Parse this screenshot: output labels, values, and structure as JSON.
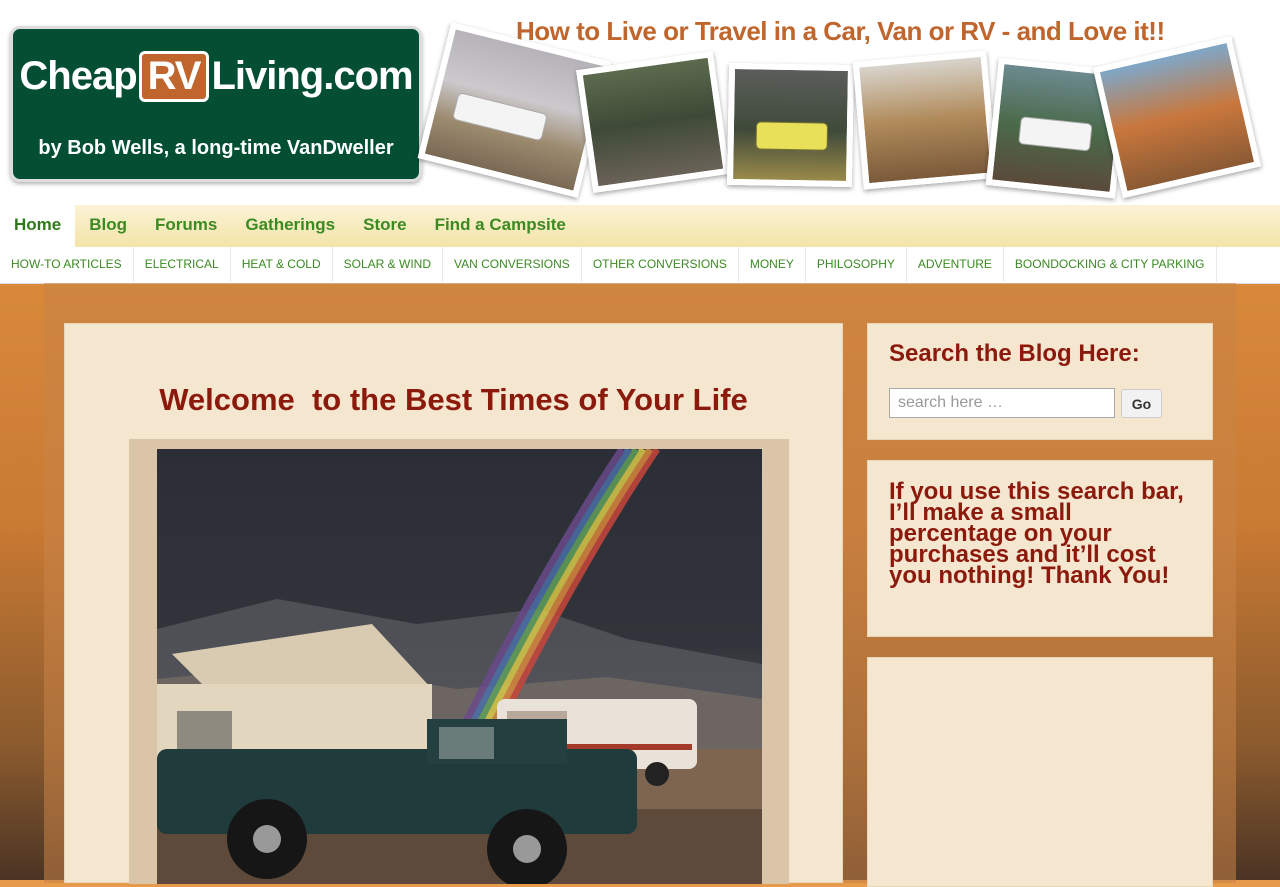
{
  "header": {
    "logo": {
      "line1_pre": "Cheap",
      "line1_mid": "RV",
      "line1_post": "Living.com",
      "line2": "by Bob Wells, a long-time VanDweller"
    },
    "tagline": "How to Live or Travel in a Car, Van or RV - and Love it!!"
  },
  "main_nav": [
    {
      "label": "Home",
      "active": true
    },
    {
      "label": "Blog"
    },
    {
      "label": "Forums"
    },
    {
      "label": "Gatherings"
    },
    {
      "label": "Store"
    },
    {
      "label": "Find a Campsite"
    }
  ],
  "sub_nav": [
    "HOW-TO ARTICLES",
    "ELECTRICAL",
    "HEAT & COLD",
    "SOLAR & WIND",
    "VAN CONVERSIONS",
    "OTHER CONVERSIONS",
    "MONEY",
    "PHILOSOPHY",
    "ADVENTURE",
    "BOONDOCKING & CITY PARKING"
  ],
  "main": {
    "title": "Welcome  to the Best Times of Your Life"
  },
  "sidebar": {
    "search_title": "Search the Blog Here:",
    "search_placeholder": "search here …",
    "go_label": "Go",
    "affiliate_text": "If you use this search bar, I’ll make a small percentage on your purchases and it’ll cost you nothing! Thank You!"
  },
  "colors": {
    "nav_green": "#3b8a23",
    "title_red": "#8b1a0d",
    "widget_bg": "#f5e6cf",
    "logo_green": "#044f34",
    "logo_orange": "#c0662c"
  }
}
